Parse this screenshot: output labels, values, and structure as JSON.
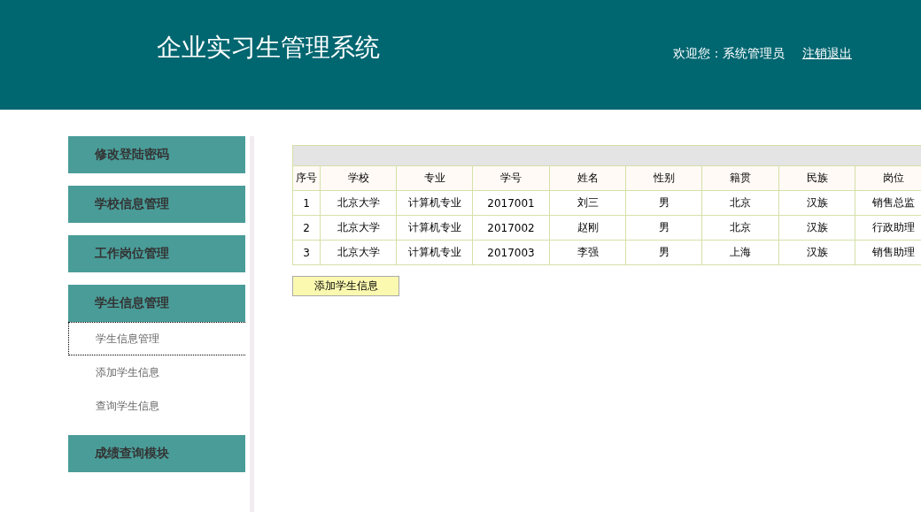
{
  "header": {
    "title": "企业实习生管理系统",
    "welcome": "欢迎您：系统管理员",
    "logout_link": "注销退出"
  },
  "sidebar": {
    "groups": [
      {
        "title": "修改登陆密码"
      },
      {
        "title": "学校信息管理"
      },
      {
        "title": "工作岗位管理"
      },
      {
        "title": "学生信息管理",
        "children": [
          {
            "label": "学生信息管理",
            "selected": true
          },
          {
            "label": "添加学生信息",
            "selected": false
          },
          {
            "label": "查询学生信息",
            "selected": false
          }
        ]
      },
      {
        "title": "成绩查询模块"
      }
    ]
  },
  "table": {
    "columns": [
      "序号",
      "学校",
      "专业",
      "学号",
      "姓名",
      "性别",
      "籍贯",
      "民族",
      "岗位"
    ],
    "rows": [
      [
        "1",
        "北京大学",
        "计算机专业",
        "2017001",
        "刘三",
        "男",
        "北京",
        "汉族",
        "销售总监"
      ],
      [
        "2",
        "北京大学",
        "计算机专业",
        "2017002",
        "赵刚",
        "男",
        "北京",
        "汉族",
        "行政助理"
      ],
      [
        "3",
        "北京大学",
        "计算机专业",
        "2017003",
        "李强",
        "男",
        "上海",
        "汉族",
        "销售助理"
      ]
    ]
  },
  "add_button": "添加学生信息"
}
